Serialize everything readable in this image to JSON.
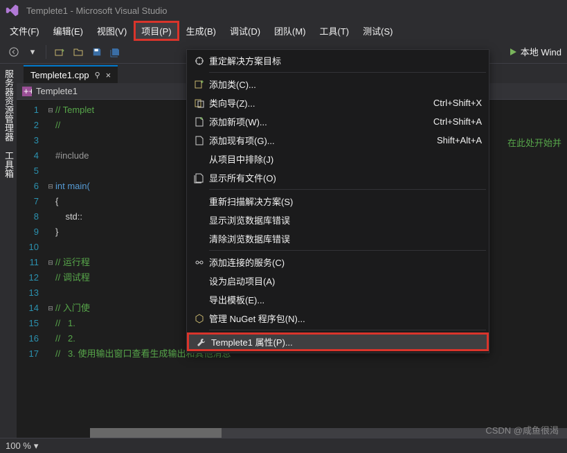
{
  "title": "Templete1 - Microsoft Visual Studio",
  "menu": [
    "文件(F)",
    "编辑(E)",
    "视图(V)",
    "项目(P)",
    "生成(B)",
    "调试(D)",
    "团队(M)",
    "工具(T)",
    "测试(S)"
  ],
  "active_menu_index": 3,
  "toolbar": {
    "run_label": "本地 Wind"
  },
  "left_rail": [
    "服务器资源管理器",
    "工具箱"
  ],
  "tab": {
    "name": "Templete1.cpp"
  },
  "breadcrumb": {
    "label": "Templete1"
  },
  "code": {
    "lines": [
      {
        "n": 1,
        "fold": "⊟",
        "cls": "c-comment",
        "text": "// Templet"
      },
      {
        "n": 2,
        "fold": "",
        "cls": "c-comment",
        "text": "//"
      },
      {
        "n": 3,
        "fold": "",
        "cls": "",
        "text": ""
      },
      {
        "n": 4,
        "fold": "",
        "cls": "c-macro",
        "text": "#include "
      },
      {
        "n": 5,
        "fold": "",
        "cls": "",
        "text": ""
      },
      {
        "n": 6,
        "fold": "⊟",
        "cls": "c-keyword",
        "text": "int main("
      },
      {
        "n": 7,
        "fold": "",
        "cls": "c-text",
        "text": "{"
      },
      {
        "n": 8,
        "fold": "",
        "cls": "c-text",
        "text": "    std::"
      },
      {
        "n": 9,
        "fold": "",
        "cls": "c-text",
        "text": "}"
      },
      {
        "n": 10,
        "fold": "",
        "cls": "",
        "text": ""
      },
      {
        "n": 11,
        "fold": "⊟",
        "cls": "c-comment",
        "text": "// 运行程"
      },
      {
        "n": 12,
        "fold": "",
        "cls": "c-comment",
        "text": "// 调试程"
      },
      {
        "n": 13,
        "fold": "",
        "cls": "",
        "text": ""
      },
      {
        "n": 14,
        "fold": "⊟",
        "cls": "c-comment",
        "text": "// 入门使"
      },
      {
        "n": 15,
        "fold": "",
        "cls": "c-comment",
        "text": "//   1. "
      },
      {
        "n": 16,
        "fold": "",
        "cls": "c-comment",
        "text": "//   2. "
      },
      {
        "n": 17,
        "fold": "",
        "cls": "c-comment",
        "text": "//   3. 使用输出窗口查看生成输出和其他消息"
      }
    ]
  },
  "context_menu": [
    {
      "icon": "retarget",
      "label": "重定解决方案目标",
      "shortcut": ""
    },
    {
      "sep": true
    },
    {
      "icon": "add-class",
      "label": "添加类(C)...",
      "shortcut": ""
    },
    {
      "icon": "wizard",
      "label": "类向导(Z)...",
      "shortcut": "Ctrl+Shift+X"
    },
    {
      "icon": "new-item",
      "label": "添加新项(W)...",
      "shortcut": "Ctrl+Shift+A"
    },
    {
      "icon": "existing-item",
      "label": "添加现有项(G)...",
      "shortcut": "Shift+Alt+A"
    },
    {
      "icon": "",
      "label": "从项目中排除(J)",
      "shortcut": ""
    },
    {
      "icon": "show-files",
      "label": "显示所有文件(O)",
      "shortcut": ""
    },
    {
      "sep": true
    },
    {
      "icon": "",
      "label": "重新扫描解决方案(S)",
      "shortcut": ""
    },
    {
      "icon": "",
      "label": "显示浏览数据库错误",
      "shortcut": ""
    },
    {
      "icon": "",
      "label": "清除浏览数据库错误",
      "shortcut": ""
    },
    {
      "sep": true
    },
    {
      "icon": "connected",
      "label": "添加连接的服务(C)",
      "shortcut": ""
    },
    {
      "icon": "",
      "label": "设为启动项目(A)",
      "shortcut": ""
    },
    {
      "icon": "",
      "label": "导出模板(E)...",
      "shortcut": ""
    },
    {
      "icon": "nuget",
      "label": "管理 NuGet 程序包(N)...",
      "shortcut": ""
    },
    {
      "sep": true
    },
    {
      "icon": "wrench",
      "label": "Templete1 属性(P)...",
      "shortcut": "",
      "highlighted": true
    }
  ],
  "hint": "在此处开始并",
  "status": {
    "zoom": "100 %"
  },
  "watermark": "CSDN @咸鱼很渴"
}
